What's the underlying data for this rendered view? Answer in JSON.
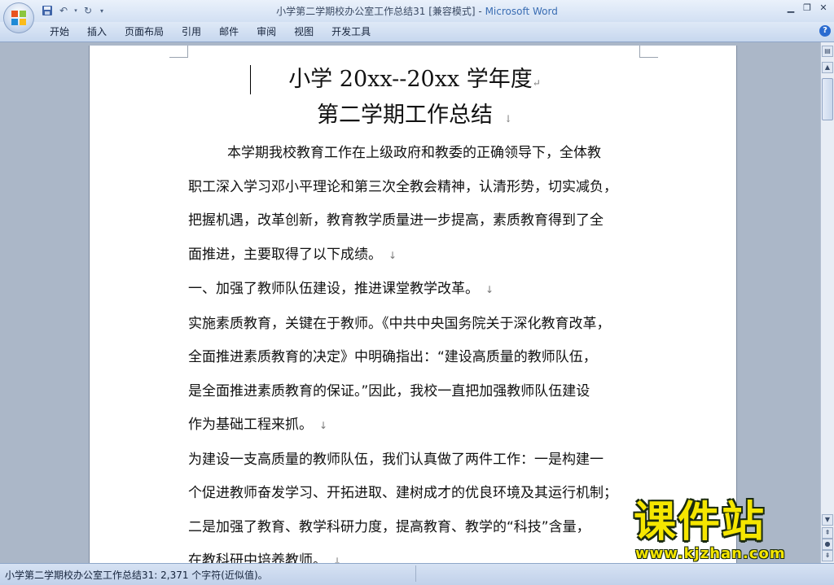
{
  "window": {
    "title": "小学第二学期校办公室工作总结31 [兼容模式]",
    "app_name": "Microsoft Word",
    "separator": " - "
  },
  "ribbon": {
    "tabs": [
      "开始",
      "插入",
      "页面布局",
      "引用",
      "邮件",
      "审阅",
      "视图",
      "开发工具"
    ],
    "help_label": "?"
  },
  "document": {
    "title_line1": "小学 20xx--20xx 学年度",
    "title_line2": "第二学期工作总结",
    "lines": [
      {
        "text": "本学期我校教育工作在上级政府和教委的正确领导下，全体教",
        "indent": true
      },
      {
        "text": "职工深入学习邓小平理论和第三次全教会精神，认清形势，切实减负，",
        "indent": false
      },
      {
        "text": "把握机遇，改革创新，教育教学质量进一步提高，素质教育得到了全",
        "indent": false
      },
      {
        "text": "面推进，主要取得了以下成绩。",
        "indent": false,
        "mark": true
      },
      {
        "text": "一、加强了教师队伍建设，推进课堂教学改革。",
        "indent": false,
        "mark": true
      },
      {
        "text": "实施素质教育，关键在于教师。《中共中央国务院关于深化教育改革，",
        "indent": false
      },
      {
        "text": "全面推进素质教育的决定》中明确指出：“建设高质量的教师队伍，",
        "indent": false
      },
      {
        "text": "是全面推进素质教育的保证。”因此，我校一直把加强教师队伍建设",
        "indent": false
      },
      {
        "text": "作为基础工程来抓。",
        "indent": false,
        "mark": true
      },
      {
        "text": "为建设一支高质量的教师队伍，我们认真做了两件工作：一是构建一",
        "indent": false
      },
      {
        "text": "个促进教师奋发学习、开拓进取、建树成才的优良环境及其运行机制；",
        "indent": false
      },
      {
        "text": "二是加强了教育、教学科研力度，提高教育、教学的“科技”含量，",
        "indent": false
      },
      {
        "text": "在教科研中培养教师。",
        "indent": false,
        "mark": true
      }
    ],
    "para_mark": "↓",
    "title_mark": "↵"
  },
  "status": {
    "text": "小学第二学期校办公室工作总结31: 2,371 个字符(近似值)。"
  },
  "watermark": {
    "main": "课件站",
    "url": "www.kjzhan.com"
  },
  "colors": {
    "title_app": "#3a6db3",
    "watermark_fill": "#f5e600"
  }
}
